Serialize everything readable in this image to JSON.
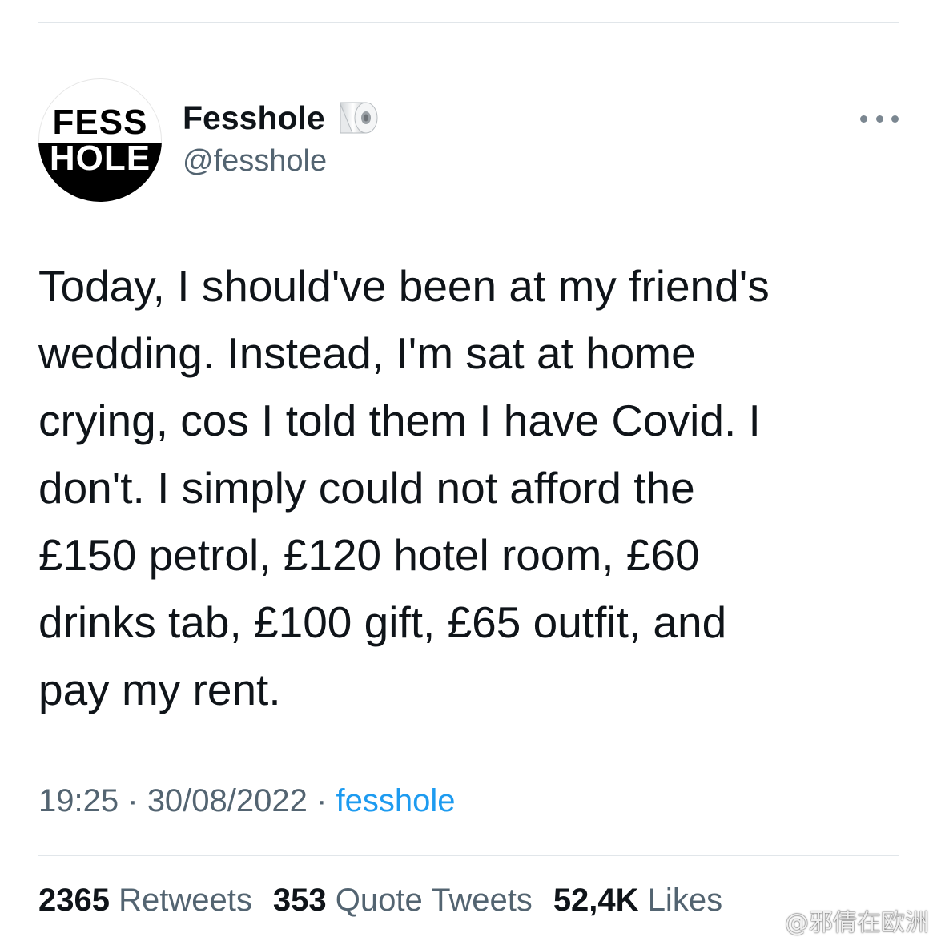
{
  "author": {
    "avatar_line_1": "FESS",
    "avatar_line_2": "HOLE",
    "display_name": "Fesshole",
    "name_emoji": "toilet-roll-emoji",
    "handle": "@fesshole"
  },
  "tweet": {
    "text": "Today, I should've been at my friend's\nwedding. Instead, I'm sat at home\ncrying, cos I told them I have Covid. I\ndon't. I simply could not afford the\n£150 petrol, £120 hotel room, £60\ndrinks tab, £100 gift, £65 outfit, and\npay my rent.",
    "time": "19:25",
    "separator": "·",
    "date": "30/08/2022",
    "source": "fesshole"
  },
  "stats": {
    "retweets_count": "2365",
    "retweets_label": "Retweets",
    "quotes_count": "353",
    "quotes_label": "Quote Tweets",
    "likes_count": "52,4K",
    "likes_label": "Likes"
  },
  "watermark": "@邪倩在欧洲",
  "colors": {
    "text_primary": "#0f1419",
    "text_secondary": "#536471",
    "link": "#1d9bf0",
    "divider": "#e1e6ea"
  }
}
